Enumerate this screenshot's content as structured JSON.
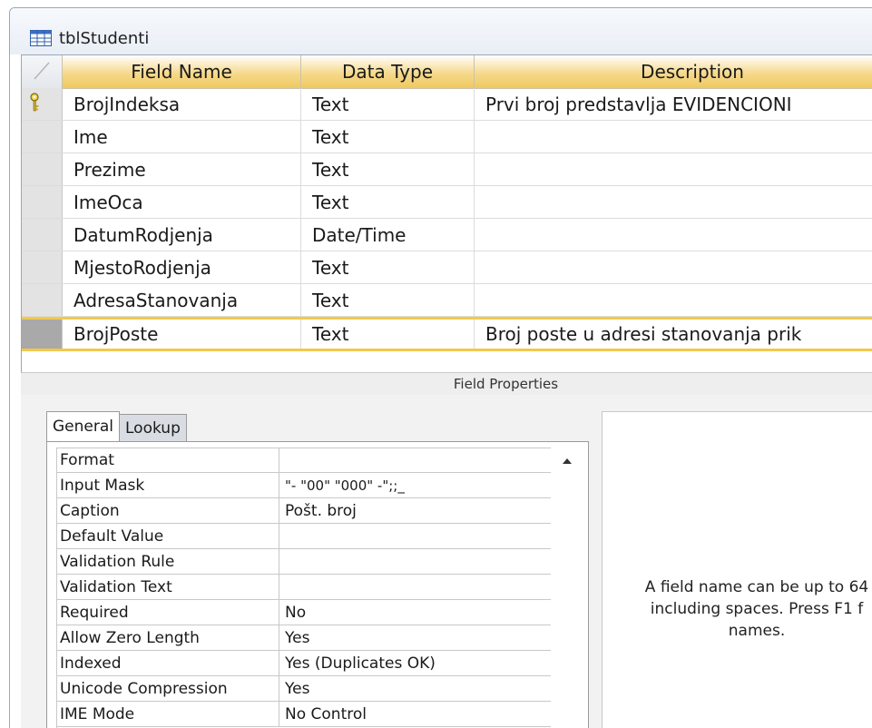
{
  "document_tab": {
    "title": "tblStudenti",
    "icon": "table-icon"
  },
  "grid": {
    "headers": [
      "Field Name",
      "Data Type",
      "Description"
    ],
    "rows": [
      {
        "field": "BrojIndeksa",
        "type": "Text",
        "description": "Prvi broj predstavlja EVIDENCIONI",
        "primary_key": true
      },
      {
        "field": "Ime",
        "type": "Text",
        "description": ""
      },
      {
        "field": "Prezime",
        "type": "Text",
        "description": ""
      },
      {
        "field": "ImeOca",
        "type": "Text",
        "description": ""
      },
      {
        "field": "DatumRodjenja",
        "type": "Date/Time",
        "description": ""
      },
      {
        "field": "MjestoRodjenja",
        "type": "Text",
        "description": ""
      },
      {
        "field": "AdresaStanovanja",
        "type": "Text",
        "description": ""
      },
      {
        "field": "BrojPoste",
        "type": "Text",
        "description": "Broj poste u adresi stanovanja prik",
        "selected": true
      }
    ]
  },
  "field_properties": {
    "title": "Field Properties",
    "tabs": [
      "General",
      "Lookup"
    ],
    "active_tab": "General",
    "properties": [
      {
        "name": "Format",
        "value": ""
      },
      {
        "name": "Input Mask",
        "value": "\"- \"00\" \"000\" -\";;_"
      },
      {
        "name": "Caption",
        "value": "Pošt. broj"
      },
      {
        "name": "Default Value",
        "value": ""
      },
      {
        "name": "Validation Rule",
        "value": ""
      },
      {
        "name": "Validation Text",
        "value": ""
      },
      {
        "name": "Required",
        "value": "No"
      },
      {
        "name": "Allow Zero Length",
        "value": "Yes"
      },
      {
        "name": "Indexed",
        "value": "Yes (Duplicates OK)"
      },
      {
        "name": "Unicode Compression",
        "value": "Yes"
      },
      {
        "name": "IME Mode",
        "value": "No Control"
      }
    ],
    "help_text": "A field name can be up to 64\nincluding spaces. Press F1 f\nnames."
  },
  "colors": {
    "header_gold": "#f0c860",
    "selected_border": "#f2c94c",
    "selector_gray": "#e3e3e3"
  }
}
